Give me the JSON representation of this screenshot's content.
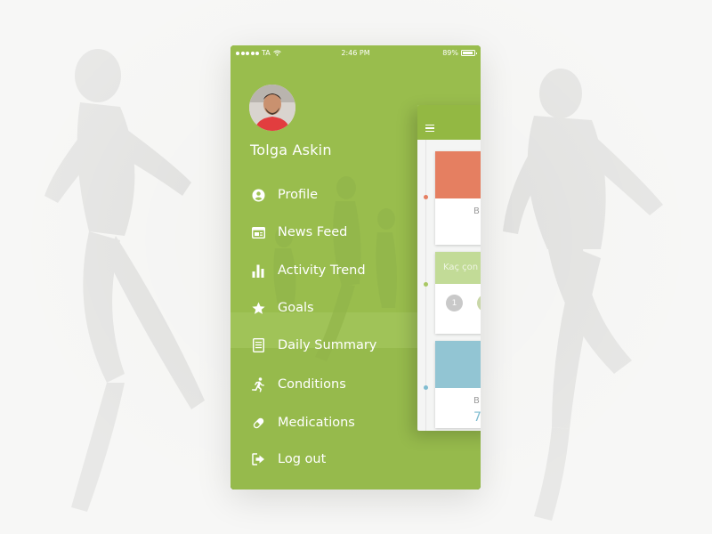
{
  "status_bar": {
    "carrier": "TA",
    "time": "2:46 PM",
    "battery": "89%"
  },
  "user": {
    "name": "Tolga Askin"
  },
  "menu": {
    "items": [
      {
        "label": "Profile",
        "icon": "account-circle-icon"
      },
      {
        "label": "News Feed",
        "icon": "news-feed-icon"
      },
      {
        "label": "Activity Trend",
        "icon": "bar-chart-icon"
      },
      {
        "label": "Goals",
        "icon": "star-icon"
      },
      {
        "label": "Daily Summary",
        "icon": "document-icon"
      },
      {
        "label": "Conditions",
        "icon": "running-icon"
      },
      {
        "label": "Medications",
        "icon": "pill-icon"
      },
      {
        "label": "Log out",
        "icon": "logout-icon"
      }
    ]
  },
  "main_screen": {
    "card1_letter": "B",
    "card2_hint": "Kaç çon",
    "card2_step": "1",
    "card3_letter": "B",
    "card3_value": "7"
  },
  "colors": {
    "drawer_green": "#9bbf4a",
    "header_green": "#93b843",
    "card_red": "#e57f61",
    "card_green": "#c2db97",
    "card_blue": "#92c5d3"
  }
}
